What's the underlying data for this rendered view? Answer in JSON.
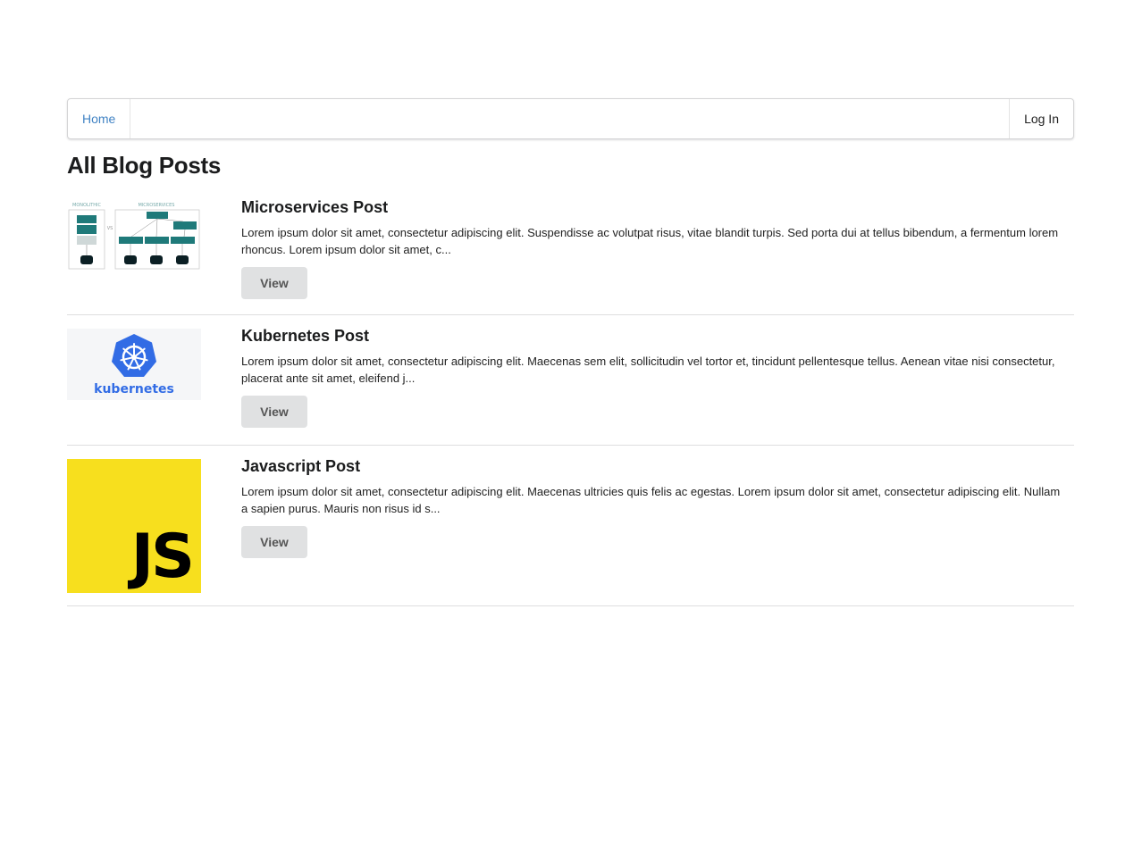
{
  "nav": {
    "home_label": "Home",
    "login_label": "Log In",
    "accent_color": "#4183c4"
  },
  "page": {
    "title": "All Blog Posts"
  },
  "posts": [
    {
      "title": "Microservices Post",
      "excerpt": "Lorem ipsum dolor sit amet, consectetur adipiscing elit. Suspendisse ac volutpat risus, vitae blandit turpis. Sed porta dui at tellus bibendum, a fermentum lorem rhoncus. Lorem ipsum dolor sit amet, c...",
      "button_label": "View",
      "image": "monolithic-vs-microservices-diagram",
      "image_labels": {
        "left": "MONOLITHIC",
        "vs": "VS",
        "right": "MICROSERVICES"
      }
    },
    {
      "title": "Kubernetes Post",
      "excerpt": "Lorem ipsum dolor sit amet, consectetur adipiscing elit. Maecenas sem elit, sollicitudin vel tortor et, tincidunt pellentesque tellus. Aenean vitae nisi consectetur, placerat ante sit amet, eleifend j...",
      "button_label": "View",
      "image": "kubernetes-logo",
      "image_text": "kubernetes"
    },
    {
      "title": "Javascript Post",
      "excerpt": "Lorem ipsum dolor sit amet, consectetur adipiscing elit. Maecenas ultricies quis felis ac egestas. Lorem ipsum dolor sit amet, consectetur adipiscing elit. Nullam a sapien purus. Mauris non risus id s...",
      "button_label": "View",
      "image": "javascript-logo",
      "image_text": "JS"
    }
  ]
}
